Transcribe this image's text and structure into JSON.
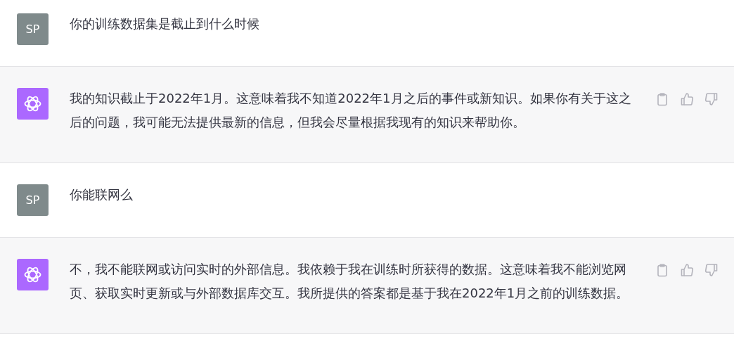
{
  "messages": [
    {
      "kind": "user",
      "avatar": "SP",
      "text": "你的训练数据集是截止到什么时候"
    },
    {
      "kind": "assistant",
      "text": "我的知识截止于2022年1月。这意味着我不知道2022年1月之后的事件或新知识。如果你有关于这之后的问题，我可能无法提供最新的信息，但我会尽量根据我现有的知识来帮助你。"
    },
    {
      "kind": "user",
      "avatar": "SP",
      "text": "你能联网么"
    },
    {
      "kind": "assistant",
      "text": "不，我不能联网或访问实时的外部信息。我依赖于我在训练时所获得的数据。这意味着我不能浏览网页、获取实时更新或与外部数据库交互。我所提供的答案都是基于我在2022年1月之前的训练数据。"
    }
  ]
}
